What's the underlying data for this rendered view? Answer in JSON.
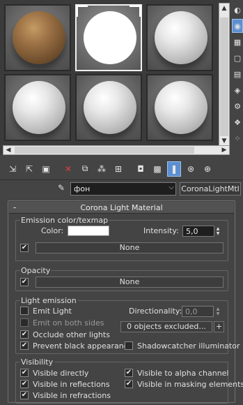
{
  "slots": [
    {
      "material": "brown",
      "active": false
    },
    {
      "material": "white",
      "active": true
    },
    {
      "material": "grey",
      "active": false
    },
    {
      "material": "grey",
      "active": false
    },
    {
      "material": "grey",
      "active": false
    },
    {
      "material": "grey",
      "active": false
    }
  ],
  "scrollbars": {
    "left_arrow": "◀",
    "right_arrow": "▶",
    "up_arrow": "▲",
    "down_arrow": "▼"
  },
  "side_toolbar": [
    "sample-type-icon",
    "backlight-icon",
    "background-icon",
    "sample-uv-icon",
    "video-color-check-icon",
    "make-preview-icon",
    "options-icon",
    "select-by-material-icon",
    "material-map-navigator-icon"
  ],
  "main_toolbar": [
    "get-material-icon",
    "put-to-scene-icon",
    "assign-to-selection-icon",
    "reset-map-icon",
    "copy-material-icon",
    "make-unique-icon",
    "put-to-library-icon",
    "material-id-channel-icon",
    "show-shaded-material-icon",
    "show-end-result-icon",
    "go-to-parent-icon",
    "go-forward-sibling-icon"
  ],
  "material_name": "фон",
  "material_type": "CoronaLightMtl",
  "rollout": {
    "toggle": "-",
    "title": "Corona Light Material"
  },
  "emission": {
    "title": "Emission color/texmap",
    "color_label": "Color:",
    "color": "#ffffff",
    "intensity_label": "Intensity:",
    "intensity_value": "5,0",
    "map_enabled": true,
    "map_label": "None"
  },
  "opacity": {
    "title": "Opacity",
    "map_enabled": true,
    "map_label": "None"
  },
  "light_emission": {
    "title": "Light emission",
    "emit_light": {
      "label": "Emit Light",
      "checked": false
    },
    "directionality_label": "Directionality:",
    "directionality_value": "0,0",
    "emit_both_sides": {
      "label": "Emit on both sides",
      "checked": false
    },
    "excluded_button": "0 objects excluded...",
    "plus_button": "+",
    "occlude_other_lights": {
      "label": "Occlude other lights",
      "checked": true
    },
    "prevent_black": {
      "label": "Prevent black appearance",
      "checked": true
    },
    "shadowcatcher": {
      "label": "Shadowcatcher illuminator",
      "checked": false
    }
  },
  "visibility": {
    "title": "Visibility",
    "visible_directly": {
      "label": "Visible directly",
      "checked": true
    },
    "visible_in_reflections": {
      "label": "Visible in reflections",
      "checked": true
    },
    "visible_in_refractions": {
      "label": "Visible in refractions",
      "checked": true
    },
    "visible_alpha": {
      "label": "Visible to alpha channel",
      "checked": true
    },
    "visible_masking": {
      "label": "Visible in masking elements",
      "checked": true
    }
  },
  "check_glyph": "✔"
}
